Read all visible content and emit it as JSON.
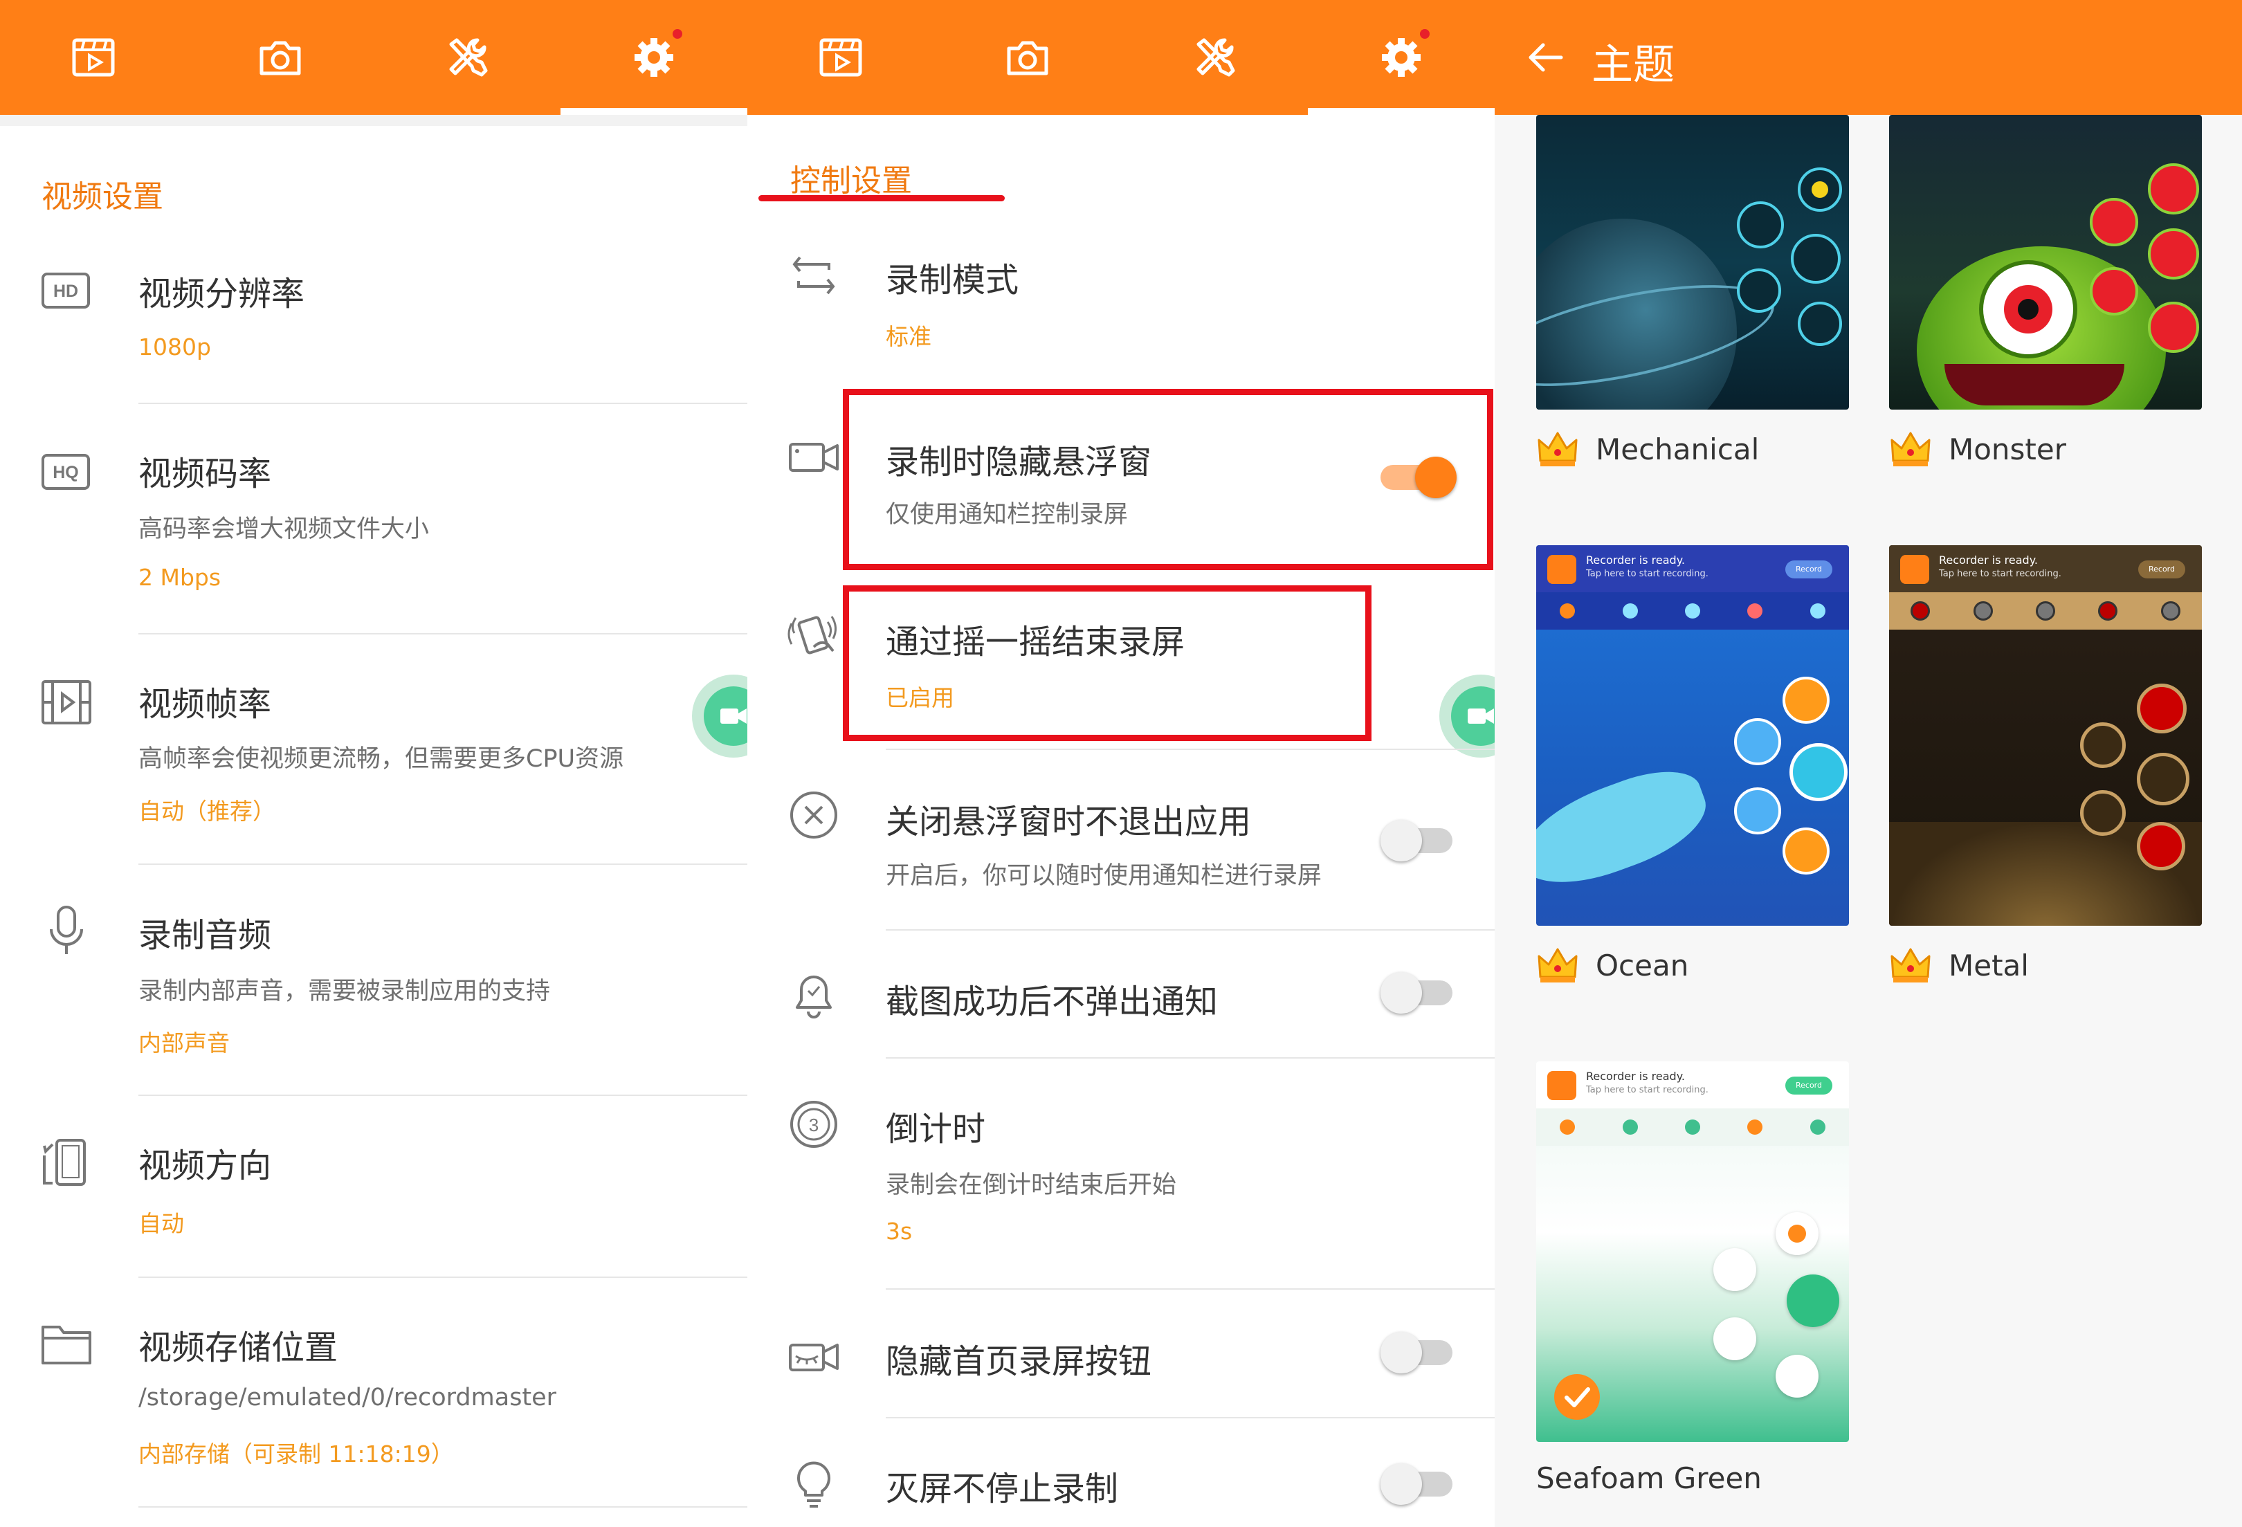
{
  "colors": {
    "accent": "#ff7f16",
    "value": "#f39a1f",
    "section": "#f07a11",
    "highlight_box": "#e8111b",
    "float_button": "#4fcf9a"
  },
  "tabs": [
    {
      "icon": "video-list-icon"
    },
    {
      "icon": "camera-icon"
    },
    {
      "icon": "tools-icon"
    },
    {
      "icon": "settings-gear-icon",
      "badge": true
    }
  ],
  "video_settings": {
    "section_title": "视频设置",
    "items": [
      {
        "icon": "hd-icon",
        "icon_text": "HD",
        "title": "视频分辨率",
        "subtitle": "",
        "value": "1080p"
      },
      {
        "icon": "hq-icon",
        "icon_text": "HQ",
        "title": "视频码率",
        "subtitle": "高码率会增大视频文件大小",
        "value": "2 Mbps"
      },
      {
        "icon": "film-icon",
        "title": "视频帧率",
        "subtitle": "高帧率会使视频更流畅，但需要更多CPU资源",
        "value": "自动（推荐）"
      },
      {
        "icon": "microphone-icon",
        "title": "录制音频",
        "subtitle": "录制内部声音，需要被录制应用的支持",
        "value": "内部声音"
      },
      {
        "icon": "rotate-phone-icon",
        "title": "视频方向",
        "subtitle": "",
        "value": "自动"
      },
      {
        "icon": "folder-icon",
        "title": "视频存储位置",
        "subtitle": "/storage/emulated/0/recordmaster",
        "value": "内部存储（可录制 11:18:19）"
      }
    ]
  },
  "control_settings": {
    "section_title": "控制设置",
    "items": [
      {
        "icon": "record-mode-icon",
        "title": "录制模式",
        "subtitle": "",
        "value": "标准"
      },
      {
        "icon": "video-camera-icon",
        "title": "录制时隐藏悬浮窗",
        "subtitle": "仅使用通知栏控制录屏",
        "toggle": true
      },
      {
        "icon": "shake-hand-icon",
        "title": "通过摇一摇结束录屏",
        "subtitle": "",
        "value": "已启用"
      },
      {
        "icon": "close-circle-icon",
        "title": "关闭悬浮窗时不退出应用",
        "subtitle": "开启后，你可以随时使用通知栏进行录屏",
        "toggle": false
      },
      {
        "icon": "bell-icon",
        "title": "截图成功后不弹出通知",
        "subtitle": "",
        "toggle": false
      },
      {
        "icon": "countdown-icon",
        "title": "倒计时",
        "subtitle": "录制会在倒计时结束后开始",
        "value": "3s"
      },
      {
        "icon": "hide-eye-camera-icon",
        "title": "隐藏首页录屏按钮",
        "subtitle": "",
        "toggle": false
      },
      {
        "icon": "bulb-icon",
        "title": "灭屏不停止录制",
        "subtitle": "",
        "toggle": false
      }
    ]
  },
  "themes_screen": {
    "title": "主题",
    "themes": [
      {
        "name": "Mechanical",
        "premium": true
      },
      {
        "name": "Monster",
        "premium": true
      },
      {
        "name": "Ocean",
        "premium": true,
        "preview": {
          "ready_title": "Recorder is ready.",
          "ready_sub": "Tap here to start recording.",
          "record_label": "Record"
        }
      },
      {
        "name": "Metal",
        "premium": true,
        "preview": {
          "ready_title": "Recorder is ready.",
          "ready_sub": "Tap here to start recording.",
          "record_label": "Record"
        }
      },
      {
        "name": "Seafoam Green",
        "premium": false,
        "selected": true,
        "preview": {
          "ready_title": "Recorder is ready.",
          "ready_sub": "Tap here to start recording.",
          "record_label": "Record"
        }
      }
    ]
  }
}
